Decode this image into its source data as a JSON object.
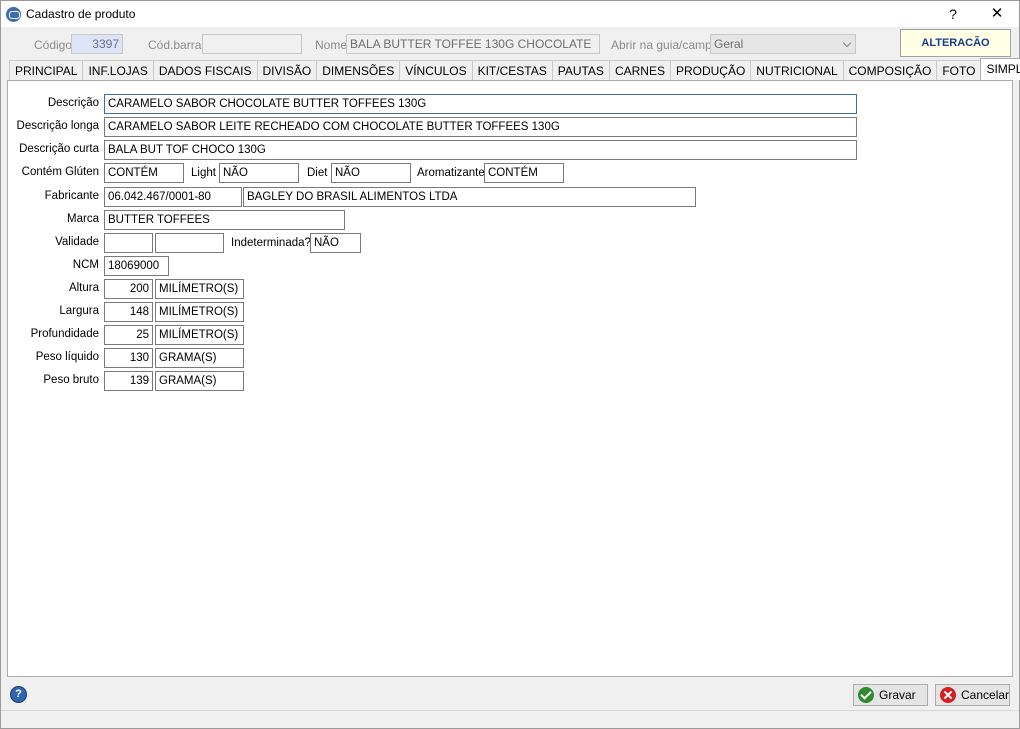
{
  "window": {
    "title": "Cadastro de produto",
    "help_glyph": "?",
    "close_glyph": "✕"
  },
  "header": {
    "codigo_label": "Código",
    "codigo_value": "3397",
    "codbarras_label": "Cód.barras",
    "codbarras_value": "",
    "nome_label": "Nome",
    "nome_value": "BALA BUTTER TOFFEE 130G CHOCOLATE",
    "abrir_label": "Abrir na guia/campo",
    "abrir_value": "Geral",
    "status": "ALTERACÃO"
  },
  "tabs": [
    {
      "label": "PRINCIPAL"
    },
    {
      "label": "INF.LOJAS"
    },
    {
      "label": "DADOS FISCAIS"
    },
    {
      "label": "DIVISÃO"
    },
    {
      "label": "DIMENSÕES"
    },
    {
      "label": "VÍNCULOS"
    },
    {
      "label": "KIT/CESTAS"
    },
    {
      "label": "PAUTAS"
    },
    {
      "label": "CARNES"
    },
    {
      "label": "PRODUÇÃO"
    },
    {
      "label": "NUTRICIONAL"
    },
    {
      "label": "COMPOSIÇÃO"
    },
    {
      "label": "FOTO"
    },
    {
      "label": "SIMPLUS"
    }
  ],
  "form": {
    "descricao_label": "Descrição",
    "descricao_value": "CARAMELO SABOR CHOCOLATE BUTTER TOFFEES 130G",
    "descricao_longa_label": "Descrição longa",
    "descricao_longa_value": "CARAMELO SABOR LEITE RECHEADO COM CHOCOLATE BUTTER TOFFEES 130G",
    "descricao_curta_label": "Descrição curta",
    "descricao_curta_value": "BALA BUT TOF CHOCO 130G",
    "gluten_label": "Contém Glúten",
    "gluten_value": "CONTÉM",
    "light_label": "Light",
    "light_value": "NÃO",
    "diet_label": "Diet",
    "diet_value": "NÃO",
    "aromatizante_label": "Aromatizante",
    "aromatizante_value": "CONTÉM",
    "fabricante_label": "Fabricante",
    "fabricante_cnpj": "06.042.467/0001-80",
    "fabricante_nome": "BAGLEY DO BRASIL ALIMENTOS LTDA",
    "marca_label": "Marca",
    "marca_value": "BUTTER TOFFEES",
    "validade_label": "Validade",
    "validade_value1": "",
    "validade_value2": "",
    "indeterminada_label": "Indeterminada?",
    "indeterminada_value": "NÃO",
    "ncm_label": "NCM",
    "ncm_value": "18069000",
    "altura_label": "Altura",
    "altura_value": "200",
    "altura_unit": "MILÍMETRO(S)",
    "largura_label": "Largura",
    "largura_value": "148",
    "largura_unit": "MILÍMETRO(S)",
    "profundidade_label": "Profundidade",
    "profundidade_value": "25",
    "profundidade_unit": "MILÍMETRO(S)",
    "peso_liquido_label": "Peso líquido",
    "peso_liquido_value": "130",
    "peso_liquido_unit": "GRAMA(S)",
    "peso_bruto_label": "Peso bruto",
    "peso_bruto_value": "139",
    "peso_bruto_unit": "GRAMA(S)"
  },
  "footer": {
    "help_glyph": "?",
    "gravar_label": "Gravar",
    "cancelar_label": "Cancelar"
  }
}
